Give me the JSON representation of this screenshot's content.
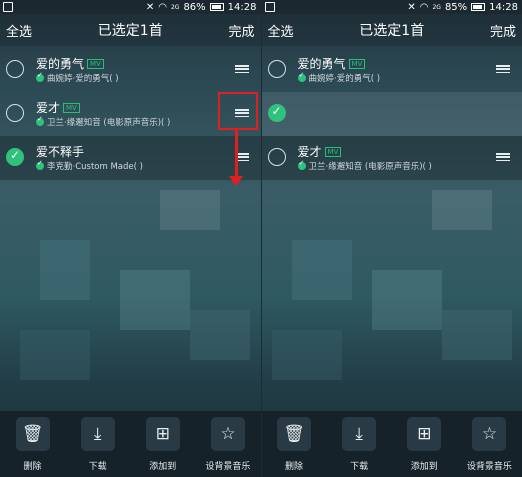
{
  "status": {
    "left": {
      "battery_pct": "86%",
      "time": "14:28",
      "signal": "2G"
    },
    "right": {
      "battery_pct": "85%",
      "time": "14:28",
      "signal": "2G"
    }
  },
  "header": {
    "select_all": "全选",
    "title": "已选定1首",
    "done": "完成"
  },
  "left_list": [
    {
      "title": "爱的勇气",
      "badge": "MV",
      "artist": "曲婉婷·爱的勇气( )",
      "selected": false
    },
    {
      "title": "爱才",
      "badge": "MV",
      "artist": "卫兰·缘邂知音 (电影原声音乐)( )",
      "selected": false
    },
    {
      "title": "爱不释手",
      "badge": "",
      "artist": "李克勤·Custom Made( )",
      "selected": true
    }
  ],
  "right_list": [
    {
      "title": "爱的勇气",
      "badge": "MV",
      "artist": "曲婉婷·爱的勇气( )",
      "selected": false
    },
    {
      "title": "",
      "badge": "",
      "artist": "",
      "selected": true
    },
    {
      "title": "爱才",
      "badge": "MV",
      "artist": "卫兰·缘邂知音 (电影原声音乐)( )",
      "selected": false
    }
  ],
  "toolbar": [
    {
      "label": "删除",
      "icon": "trash-icon"
    },
    {
      "label": "下载",
      "icon": "download-icon"
    },
    {
      "label": "添加到",
      "icon": "add-to-icon"
    },
    {
      "label": "设背景音乐",
      "icon": "star-icon"
    }
  ],
  "colors": {
    "accent": "#2ec27e",
    "annotation": "#e02020"
  }
}
